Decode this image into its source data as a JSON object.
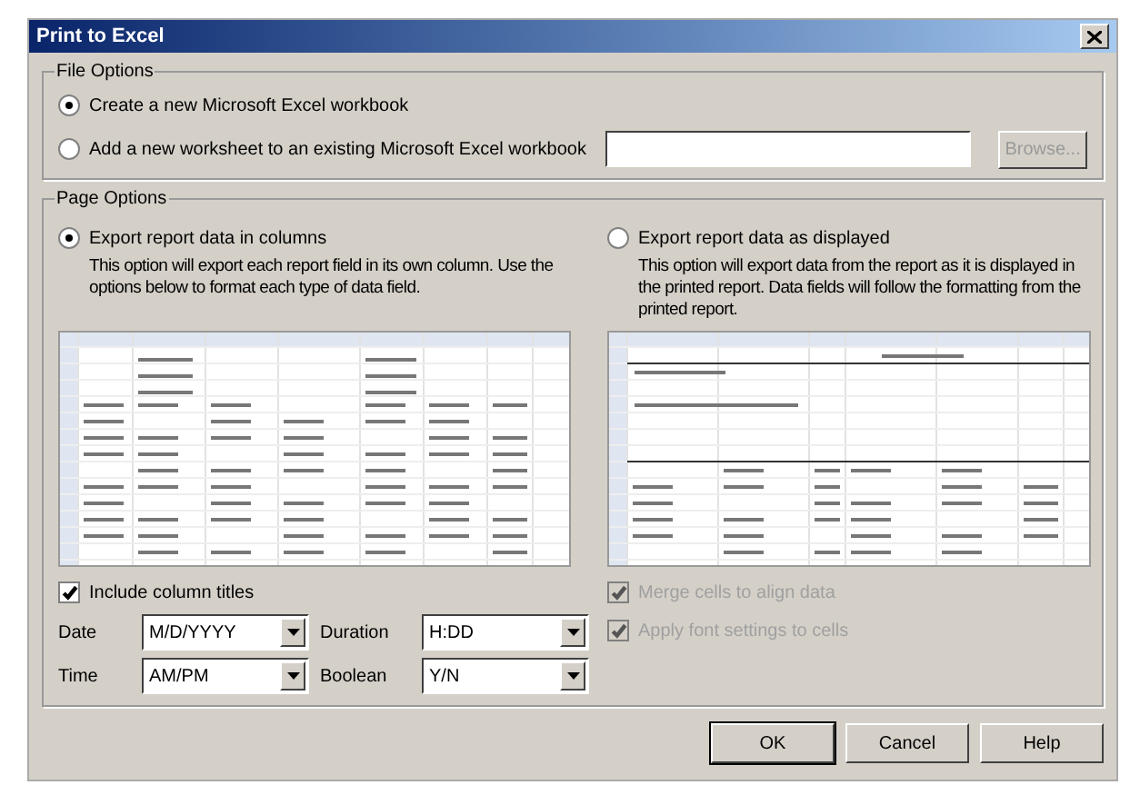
{
  "window": {
    "title": "Print to Excel"
  },
  "file_options": {
    "title": "File Options",
    "options": [
      {
        "label": "Create a new Microsoft Excel workbook",
        "selected": true
      },
      {
        "label": "Add a new worksheet to an existing Microsoft Excel workbook",
        "selected": false
      }
    ],
    "browse_button": {
      "label": "Browse...",
      "disabled": true
    }
  },
  "page_options": {
    "title": "Page Options",
    "modes": [
      {
        "label": "Export report data in columns",
        "description": "This option will export each report field in its own column. Use the options below to format each type of data field.",
        "selected": true
      },
      {
        "label": "Export report data as displayed",
        "description": "This option will export data from the report as it is displayed in the printed report. Data fields will follow the formatting from the printed report.",
        "selected": false
      }
    ],
    "include_titles": {
      "label": "Include column titles",
      "checked": true
    },
    "formats": [
      {
        "label": "Date",
        "value": "M/D/YYYY"
      },
      {
        "label": "Duration",
        "value": "H:DD"
      },
      {
        "label": "Time",
        "value": "AM/PM"
      },
      {
        "label": "Boolean",
        "value": "Y/N"
      }
    ],
    "display_options": [
      {
        "label": "Merge cells to align data",
        "checked": true,
        "disabled": true
      },
      {
        "label": "Apply font settings to cells",
        "checked": true,
        "disabled": true
      }
    ]
  },
  "buttons": [
    "OK",
    "Cancel",
    "Help"
  ]
}
